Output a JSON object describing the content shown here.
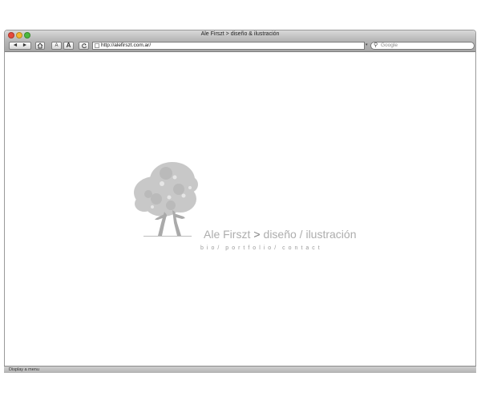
{
  "window": {
    "title": "Ale Firszt > diseño & ilustración"
  },
  "toolbar": {
    "back_icon": "◄",
    "forward_icon": "►",
    "font_small_label": "A",
    "font_large_label": "A",
    "url": "http://alefirszt.com.ar/",
    "search_placeholder": "Google"
  },
  "page": {
    "brand_name": "Ale Firszt",
    "brand_separator": ">",
    "brand_tagline": "diseño / ilustración",
    "nav": [
      "bio/",
      "portfolio/",
      "contact"
    ]
  },
  "status": {
    "text": "Display a menu"
  },
  "colors": {
    "brand_gray": "#adadad",
    "separator_gray": "#7d7d7d",
    "chrome": "#b8b8b8"
  }
}
